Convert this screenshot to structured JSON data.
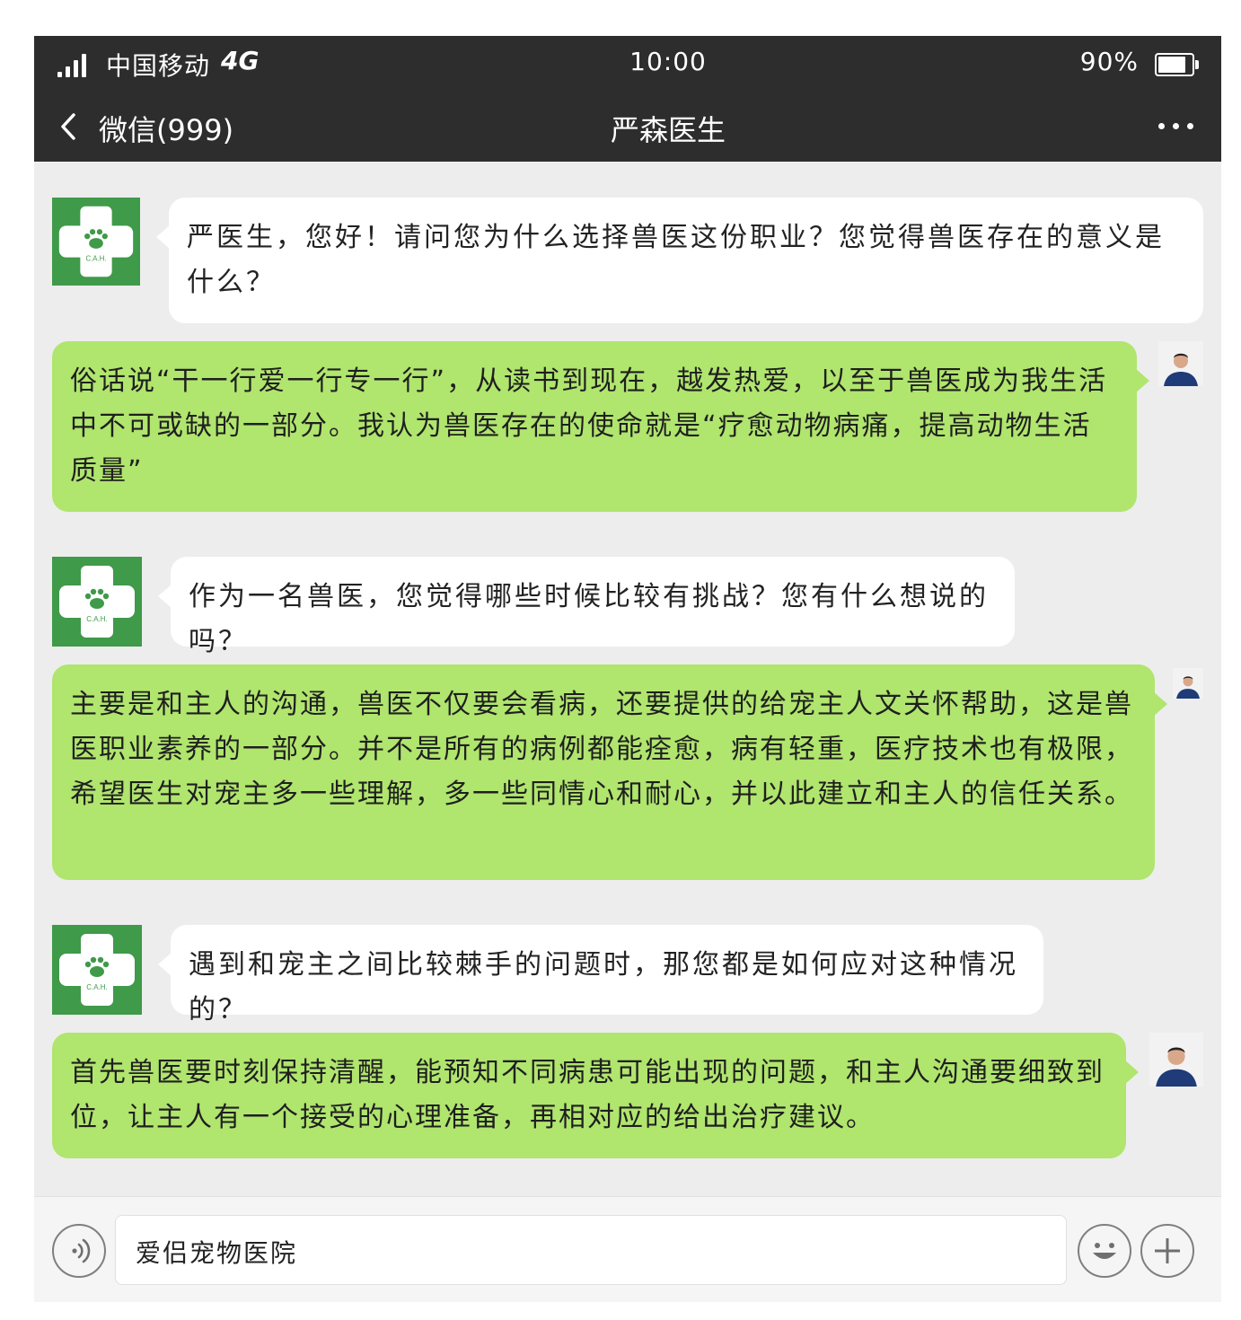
{
  "status_bar": {
    "carrier": "中国移动",
    "network": "4G",
    "time": "10:00",
    "battery_percent": "90%",
    "battery_level": 0.9,
    "signal_bars": 4
  },
  "nav": {
    "back_label": "微信(999)",
    "title": "严森医生",
    "more_icon": "more-dots-icon"
  },
  "colors": {
    "header_bg": "#2d2d2d",
    "chat_bg": "#ededed",
    "incoming_bubble": "#ffffff",
    "outgoing_bubble": "#b0e56e",
    "logo_green": "#3f9a49"
  },
  "clinic_logo": {
    "icon": "paw-cross-logo-icon",
    "text": "C.A.H."
  },
  "messages": [
    {
      "side": "in",
      "text": "严医生，您好！请问您为什么选择兽医这份职业？您觉得兽医存在的意义是什么？"
    },
    {
      "side": "out",
      "text": "俗话说“干一行爱一行专一行”，从读书到现在，越发热爱，以至于兽医成为我生活中不可或缺的一部分。我认为兽医存在的使命就是“疗愈动物病痛，提高动物生活质量”"
    },
    {
      "side": "in",
      "text": "作为一名兽医，您觉得哪些时候比较有挑战？您有什么想说的吗？"
    },
    {
      "side": "out",
      "text": "主要是和主人的沟通，兽医不仅要会看病，还要提供的给宠主人文关怀帮助，这是兽医职业素养的一部分。并不是所有的病例都能痊愈，病有轻重，医疗技术也有极限，希望医生对宠主多一些理解，多一些同情心和耐心，并以此建立和主人的信任关系。"
    },
    {
      "side": "in",
      "text": "遇到和宠主之间比较棘手的问题时，那您都是如何应对这种情况的？"
    },
    {
      "side": "out",
      "text": "首先兽医要时刻保持清醒，能预知不同病患可能出现的问题，和主人沟通要细致到位，让主人有一个接受的心理准备，再相对应的给出治疗建议。"
    }
  ],
  "input_bar": {
    "voice_icon": "voice-icon",
    "text": "爱侣宠物医院",
    "emoji_icon": "emoji-icon",
    "plus_icon": "plus-icon"
  }
}
